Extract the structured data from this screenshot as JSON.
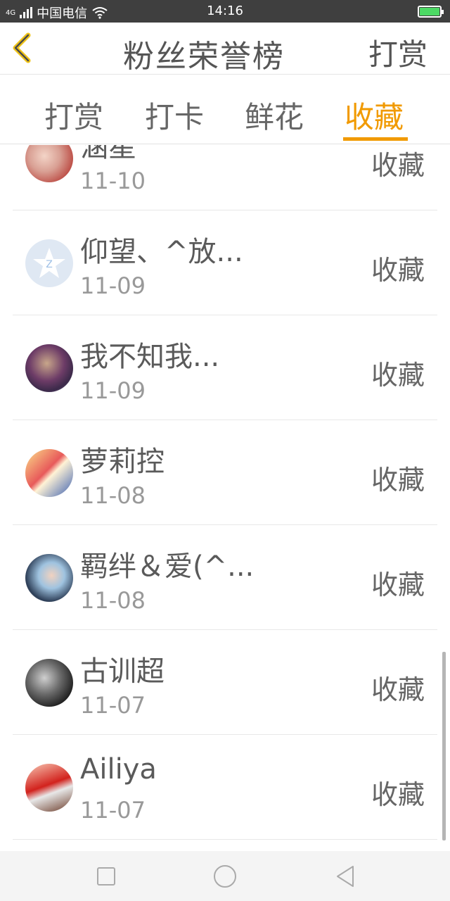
{
  "status_bar": {
    "network": "4G",
    "carrier": "中国电信",
    "time": "14:16"
  },
  "header": {
    "title": "粉丝荣誉榜",
    "right_label": "打赏"
  },
  "tabs": [
    {
      "label": "打赏",
      "active": false
    },
    {
      "label": "打卡",
      "active": false
    },
    {
      "label": "鲜花",
      "active": false
    },
    {
      "label": "收藏",
      "active": true
    }
  ],
  "accent_color": "#f19a00",
  "list": [
    {
      "name": "涵星",
      "date": "11-10",
      "action": "收藏"
    },
    {
      "name": "仰望、^放...",
      "date": "11-09",
      "action": "收藏"
    },
    {
      "name": "我不知我...",
      "date": "11-09",
      "action": "收藏"
    },
    {
      "name": "萝莉控",
      "date": "11-08",
      "action": "收藏"
    },
    {
      "name": "羁绊＆爱(^...",
      "date": "11-08",
      "action": "收藏"
    },
    {
      "name": "古训超",
      "date": "11-07",
      "action": "收藏"
    },
    {
      "name": "Ailiya",
      "date": "11-07",
      "action": "收藏"
    }
  ]
}
